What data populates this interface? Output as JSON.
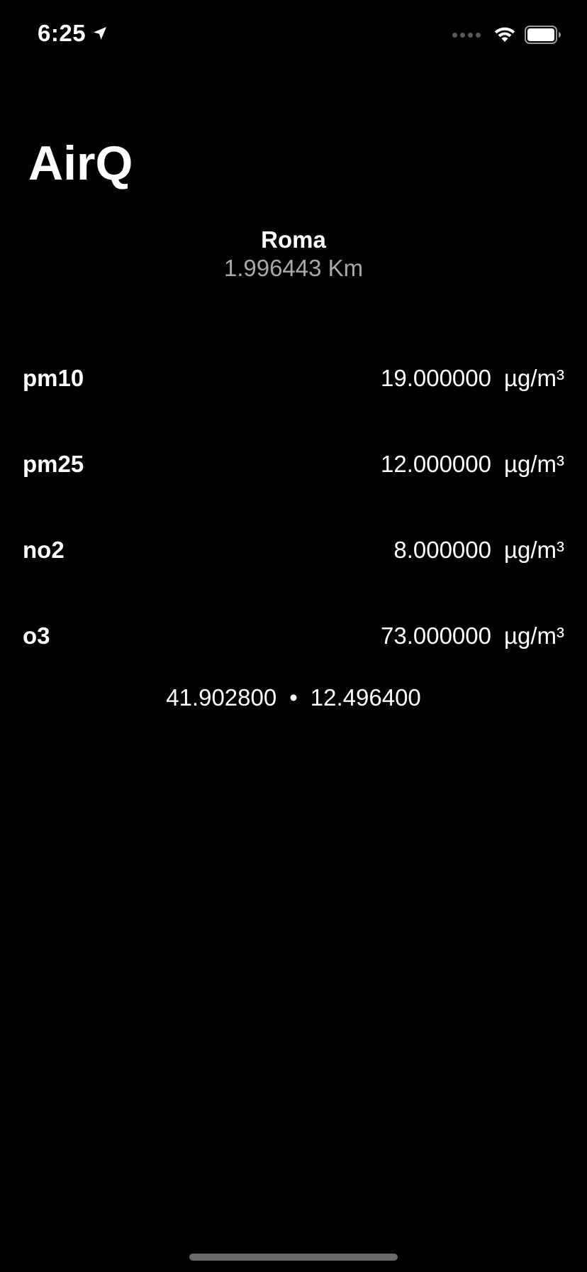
{
  "status_bar": {
    "time": "6:25",
    "icons": [
      "location-arrow-icon",
      "signal-icon",
      "wifi-icon",
      "battery-icon"
    ]
  },
  "app": {
    "title": "AirQ"
  },
  "station": {
    "name": "Roma",
    "distance": "1.996443 Km"
  },
  "pollutants": [
    {
      "name": "pm10",
      "value": "19.000000",
      "unit": "µg/m³"
    },
    {
      "name": "pm25",
      "value": "12.000000",
      "unit": "µg/m³"
    },
    {
      "name": "no2",
      "value": "8.000000",
      "unit": "µg/m³"
    },
    {
      "name": "o3",
      "value": "73.000000",
      "unit": "µg/m³"
    }
  ],
  "coordinates": {
    "lat": "41.902800",
    "separator": "•",
    "lon": "12.496400"
  },
  "colors": {
    "background": "#000000",
    "text": "#ffffff",
    "secondary_text": "#a9a9a9"
  }
}
